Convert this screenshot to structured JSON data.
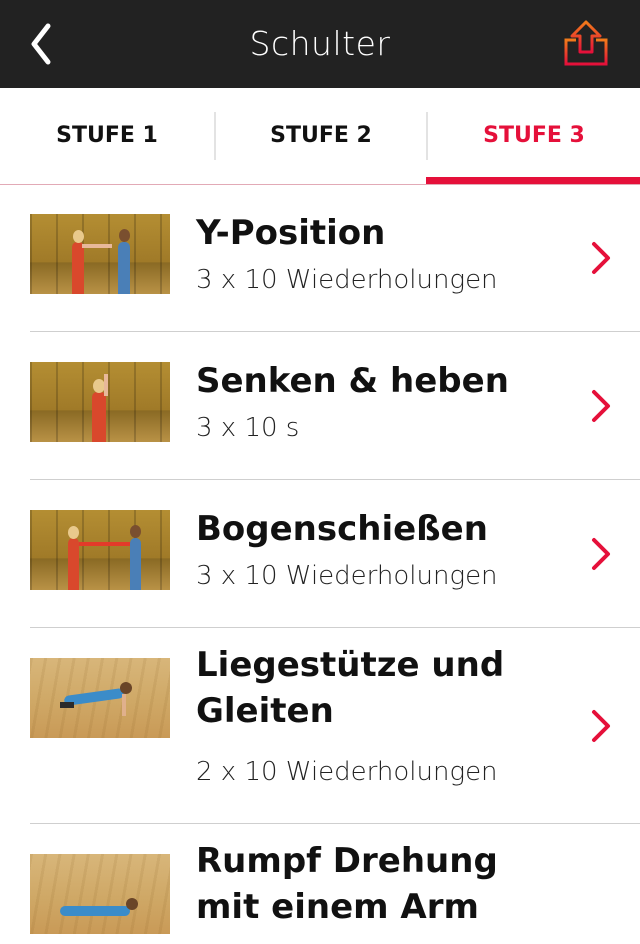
{
  "header": {
    "title": "Schulter",
    "back_icon": "chevron-left-icon",
    "share_icon": "share-upload-icon",
    "accent": "#e5103a"
  },
  "tabs": [
    {
      "label": "STUFE 1",
      "active": false
    },
    {
      "label": "STUFE 2",
      "active": false
    },
    {
      "label": "STUFE 3",
      "active": true
    }
  ],
  "exercises": [
    {
      "name": "Y-Position",
      "detail": "3 x 10 Wiederholungen"
    },
    {
      "name": "Senken & heben",
      "detail": "3 x 10 s"
    },
    {
      "name": "Bogenschießen",
      "detail": "3 x 10 Wiederholungen"
    },
    {
      "name": "Liegestütze und Gleiten",
      "detail": "2 x 10 Wiederholungen"
    },
    {
      "name": "Rumpf Drehung mit einem Arm",
      "detail": ""
    }
  ]
}
